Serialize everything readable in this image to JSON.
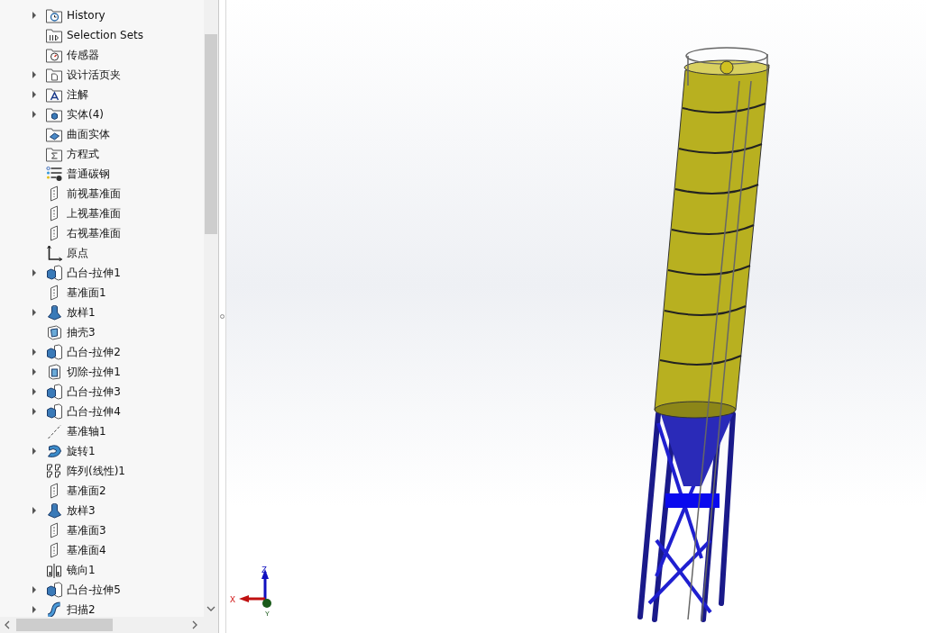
{
  "feature_tree": [
    {
      "label": "History",
      "kind": "history",
      "expandable": true
    },
    {
      "label": "Selection Sets",
      "kind": "selection",
      "expandable": false
    },
    {
      "label": "传感器",
      "kind": "sensor",
      "expandable": false
    },
    {
      "label": "设计活页夹",
      "kind": "design",
      "expandable": true
    },
    {
      "label": "注解",
      "kind": "annotation",
      "expandable": true
    },
    {
      "label": "实体(4)",
      "kind": "solid",
      "expandable": true
    },
    {
      "label": "曲面实体",
      "kind": "surface",
      "expandable": false
    },
    {
      "label": "方程式",
      "kind": "equation",
      "expandable": false
    },
    {
      "label": "普通碳钢",
      "kind": "material",
      "expandable": false
    },
    {
      "label": "前视基准面",
      "kind": "plane",
      "expandable": false
    },
    {
      "label": "上视基准面",
      "kind": "plane",
      "expandable": false
    },
    {
      "label": "右视基准面",
      "kind": "plane",
      "expandable": false
    },
    {
      "label": "原点",
      "kind": "origin",
      "expandable": false
    },
    {
      "label": "凸台-拉伸1",
      "kind": "extrude",
      "expandable": true
    },
    {
      "label": "基准面1",
      "kind": "plane",
      "expandable": false
    },
    {
      "label": "放样1",
      "kind": "loft",
      "expandable": true
    },
    {
      "label": "抽壳3",
      "kind": "shell",
      "expandable": false
    },
    {
      "label": "凸台-拉伸2",
      "kind": "extrude",
      "expandable": true
    },
    {
      "label": "切除-拉伸1",
      "kind": "cut",
      "expandable": true
    },
    {
      "label": "凸台-拉伸3",
      "kind": "extrude",
      "expandable": true
    },
    {
      "label": "凸台-拉伸4",
      "kind": "extrude",
      "expandable": true
    },
    {
      "label": "基准轴1",
      "kind": "axis",
      "expandable": false
    },
    {
      "label": "旋转1",
      "kind": "revolve",
      "expandable": true
    },
    {
      "label": "阵列(线性)1",
      "kind": "pattern",
      "expandable": false
    },
    {
      "label": "基准面2",
      "kind": "plane",
      "expandable": false
    },
    {
      "label": "放样3",
      "kind": "loft",
      "expandable": true
    },
    {
      "label": "基准面3",
      "kind": "plane",
      "expandable": false
    },
    {
      "label": "基准面4",
      "kind": "plane",
      "expandable": false
    },
    {
      "label": "镜向1",
      "kind": "mirror",
      "expandable": false
    },
    {
      "label": "凸台-拉伸5",
      "kind": "extrude",
      "expandable": true
    },
    {
      "label": "扫描2",
      "kind": "sweep",
      "expandable": true
    }
  ],
  "viewport": {
    "triad": {
      "x_label": "X",
      "y_label": "Y",
      "z_label": "Z"
    }
  }
}
